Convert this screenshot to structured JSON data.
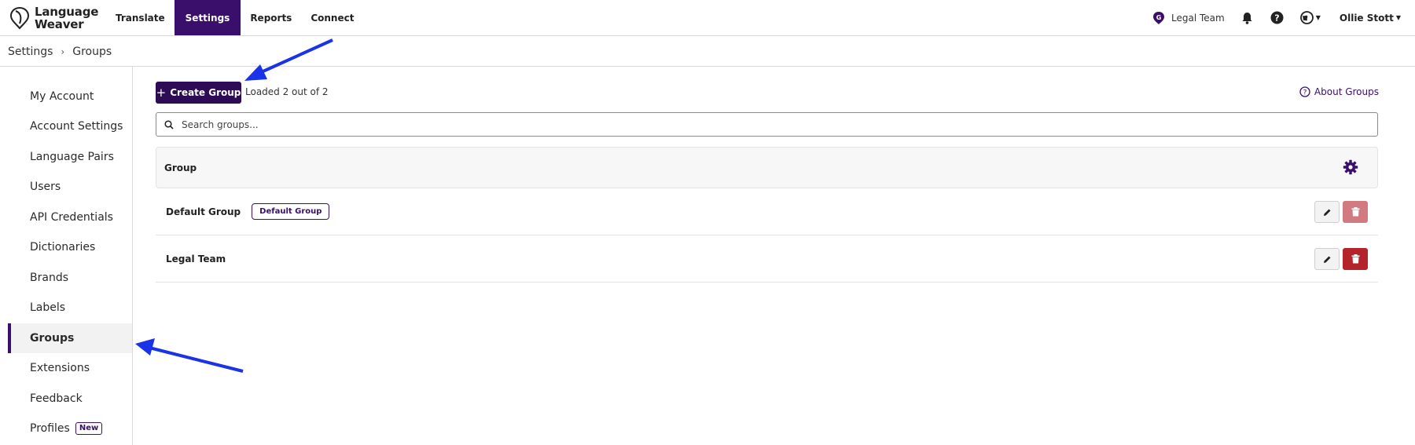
{
  "app": {
    "logo_line1": "Language",
    "logo_line2": "Weaver"
  },
  "nav": {
    "items": [
      {
        "label": "Translate"
      },
      {
        "label": "Settings"
      },
      {
        "label": "Reports"
      },
      {
        "label": "Connect"
      }
    ],
    "active": "Settings"
  },
  "header": {
    "team_name": "Legal Team",
    "team_initial": "G",
    "user_name": "Ollie Stott"
  },
  "breadcrumb": {
    "items": [
      "Settings",
      "Groups"
    ],
    "separator": "›"
  },
  "sidebar": {
    "items": [
      {
        "label": "My Account"
      },
      {
        "label": "Account Settings"
      },
      {
        "label": "Language Pairs"
      },
      {
        "label": "Users"
      },
      {
        "label": "API Credentials"
      },
      {
        "label": "Dictionaries"
      },
      {
        "label": "Brands"
      },
      {
        "label": "Labels"
      },
      {
        "label": "Groups"
      },
      {
        "label": "Extensions"
      },
      {
        "label": "Feedback"
      },
      {
        "label": "Profiles",
        "badge": "New"
      }
    ],
    "active": "Groups"
  },
  "main": {
    "create_button_label": "Create Group",
    "loaded_text": "Loaded 2 out of 2",
    "about_link": "About Groups",
    "search_placeholder": "Search groups...",
    "table": {
      "header": "Group",
      "rows": [
        {
          "name": "Default Group",
          "badge": "Default Group",
          "delete_enabled": false
        },
        {
          "name": "Legal Team",
          "badge": "",
          "delete_enabled": true
        }
      ]
    }
  },
  "colors": {
    "brand": "#3a0e6b",
    "primary_button": "#2d0b55",
    "delete": "#b3242b",
    "delete_disabled": "#d17b80",
    "annotation_arrow": "#1a33e8"
  },
  "icons": [
    "logo-icon",
    "team-icon",
    "bell-icon",
    "help-icon",
    "globe-icon",
    "chevron-right-icon",
    "plus-icon",
    "question-circle-icon",
    "search-icon",
    "gear-icon",
    "pencil-icon",
    "trash-icon"
  ]
}
